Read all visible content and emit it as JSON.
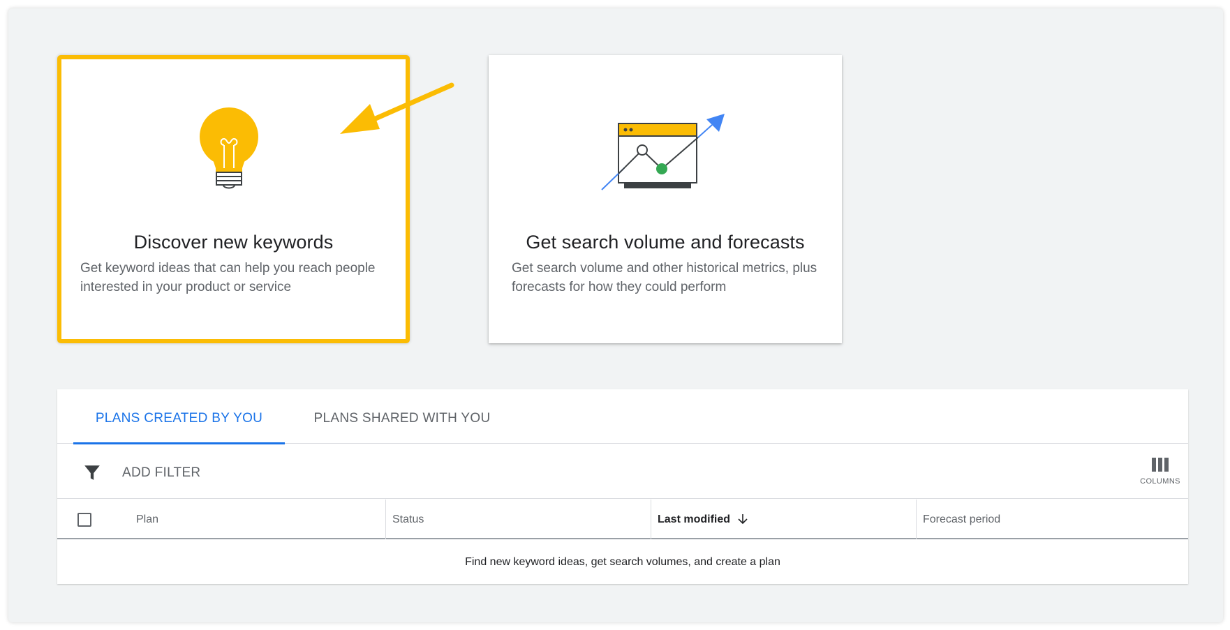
{
  "cards": {
    "discover": {
      "title": "Discover new keywords",
      "description": "Get keyword ideas that can help you reach people interested in your product or service",
      "icon": "lightbulb-icon"
    },
    "forecast": {
      "title": "Get search volume and forecasts",
      "description": "Get search volume and other historical metrics, plus forecasts for how they could perform",
      "icon": "trend-chart-icon"
    }
  },
  "tabs": {
    "created": "PLANS CREATED BY YOU",
    "shared": "PLANS SHARED WITH YOU"
  },
  "filter": {
    "label": "ADD FILTER",
    "columns_label": "COLUMNS"
  },
  "table": {
    "columns": [
      "Plan",
      "Status",
      "Last modified",
      "Forecast period"
    ],
    "empty_message": "Find new keyword ideas, get search volumes, and create a plan"
  },
  "colors": {
    "highlight": "#fbbc04",
    "accent": "#1a73e8",
    "success": "#34a853"
  }
}
